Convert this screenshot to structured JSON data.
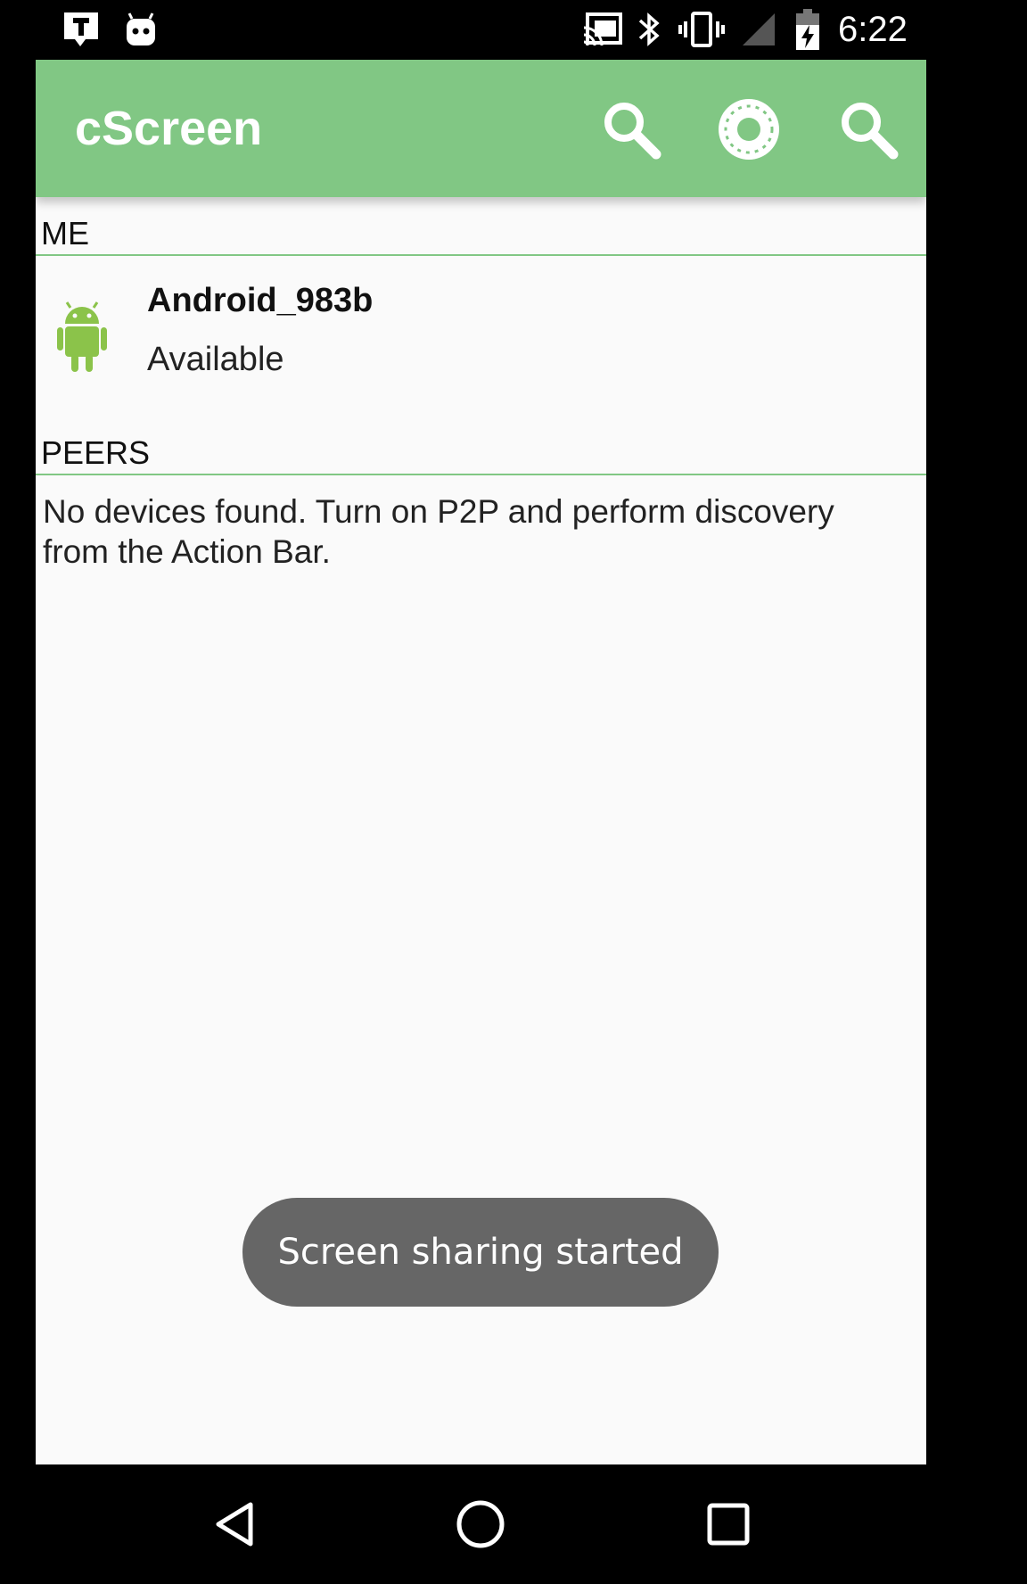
{
  "status_bar": {
    "time": "6:22",
    "icons": [
      "notification-t-icon",
      "android-debug-icon",
      "cast-icon",
      "bluetooth-icon",
      "vibrate-icon",
      "signal-icon",
      "battery-charging-icon"
    ]
  },
  "app_bar": {
    "title": "cScreen",
    "actions": [
      "search-icon",
      "settings-icon",
      "search-icon"
    ],
    "color": "#81c784"
  },
  "me_section": {
    "header": "ME",
    "device": {
      "name": "Android_983b",
      "status": "Available",
      "icon": "android-robot-icon"
    }
  },
  "peers_section": {
    "header": "PEERS",
    "empty_message": "No devices found. Turn on P2P and perform discovery from the Action Bar."
  },
  "toast": {
    "message": "Screen sharing started"
  },
  "nav_bar": {
    "buttons": [
      "back-icon",
      "home-icon",
      "recents-icon"
    ]
  }
}
